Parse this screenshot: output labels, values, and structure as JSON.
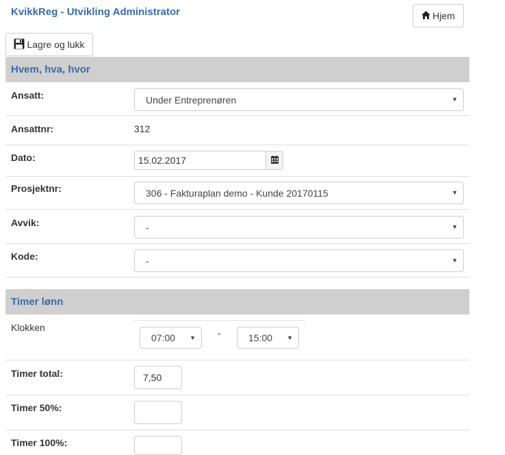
{
  "header": {
    "title": "KvikkReg - Utvikling Administrator",
    "home_label": "Hjem",
    "save_label": "Lagre og lukk"
  },
  "sections": {
    "who_what_where": "Hvem, hva, hvor",
    "hours": "Timer lønn"
  },
  "fields": {
    "employee": {
      "label": "Ansatt:",
      "value": "Under Entreprenøren"
    },
    "employee_no": {
      "label": "Ansattnr:",
      "value": "312"
    },
    "date": {
      "label": "Dato:",
      "value": "15.02.2017"
    },
    "project": {
      "label": "Prosjektnr:",
      "value": "306 - Fakturaplan demo - Kunde 20170115"
    },
    "deviation": {
      "label": "Avvik:",
      "value": "-"
    },
    "code": {
      "label": "Kode:",
      "value": "-"
    },
    "clock": {
      "label": "Klokken",
      "from": "07:00",
      "separator": "-",
      "to": "15:00"
    },
    "hours_total": {
      "label": "Timer total:",
      "value": "7,50"
    },
    "hours_50": {
      "label": "Timer 50%:",
      "value": ""
    },
    "hours_100": {
      "label": "Timer 100%:",
      "value": ""
    }
  },
  "icons": {
    "home": "home-icon",
    "save": "floppy-disk-icon",
    "calendar": "calendar-icon",
    "dropdown": "caret-down-icon"
  }
}
